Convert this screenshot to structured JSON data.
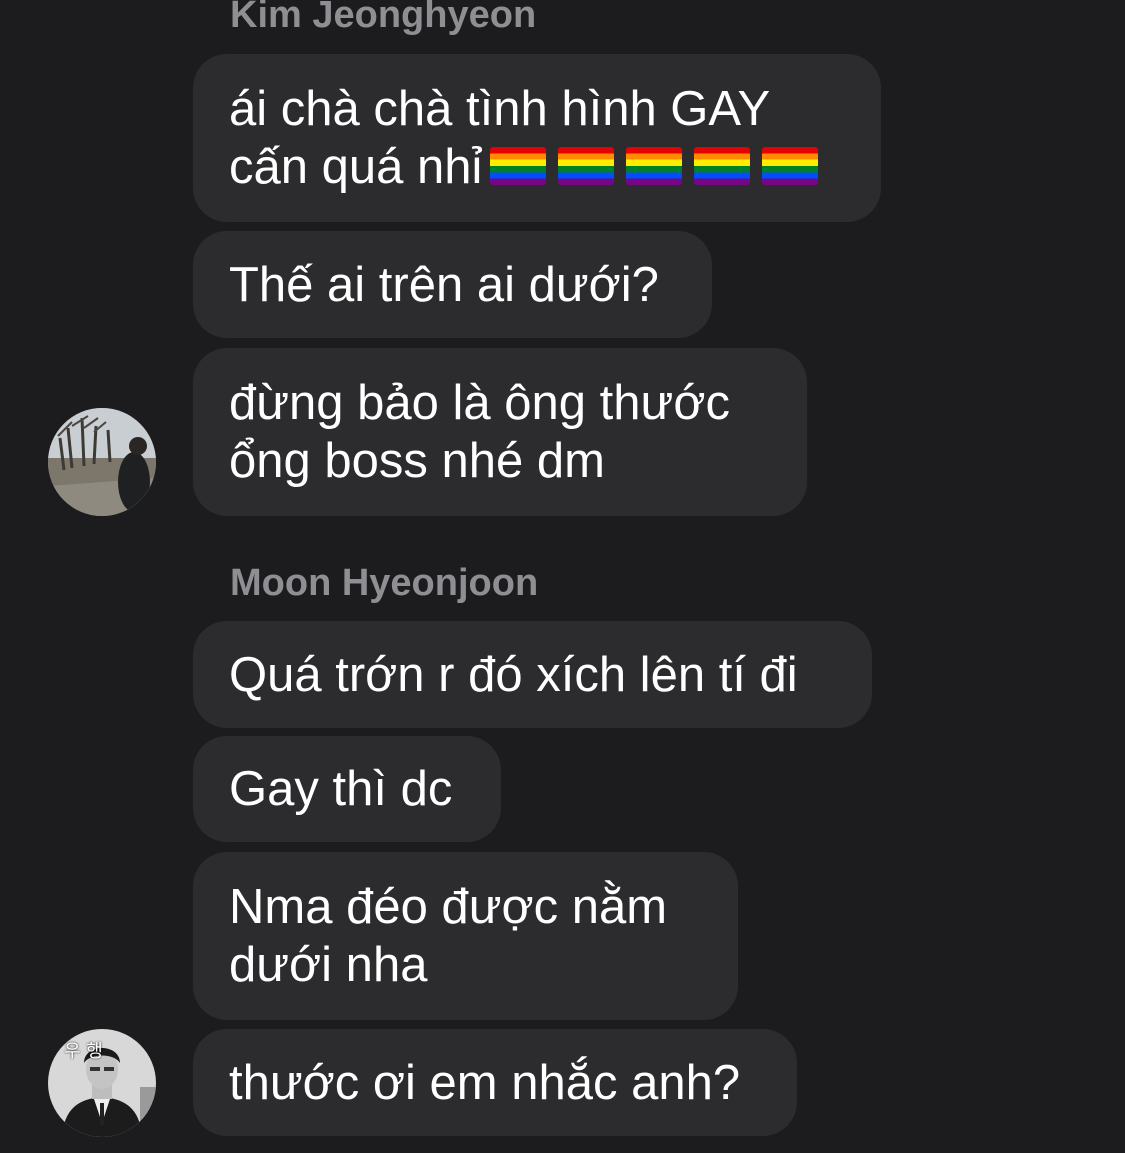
{
  "group1": {
    "sender": "Kim Jeonghyeon",
    "messages": [
      {
        "lines": [
          "ái chà chà tình hình GAY",
          "cấn quá nhỉ"
        ]
      },
      {
        "lines": [
          "Thế ai trên ai dưới?"
        ]
      },
      {
        "lines": [
          "đừng bảo là ông thước",
          "ổng boss nhé dm"
        ]
      }
    ],
    "emoji": [
      "rainbow-flag",
      "rainbow-flag",
      "rainbow-flag",
      "rainbow-flag",
      "rainbow-flag"
    ]
  },
  "group2": {
    "sender": "Moon Hyeonjoon",
    "avatar_text": "우 행",
    "messages": [
      {
        "lines": [
          "Quá trớn r đó xích lên tí đi"
        ]
      },
      {
        "lines": [
          "Gay thì dc"
        ]
      },
      {
        "lines": [
          "Nma đéo được nằm",
          "dưới nha"
        ]
      },
      {
        "lines": [
          "thước ơi em nhắc anh?"
        ]
      }
    ]
  },
  "colors": {
    "background": "#1c1c1e",
    "bubble": "#2c2c2e",
    "sender_name": "#8e8e93",
    "text": "#ffffff"
  }
}
